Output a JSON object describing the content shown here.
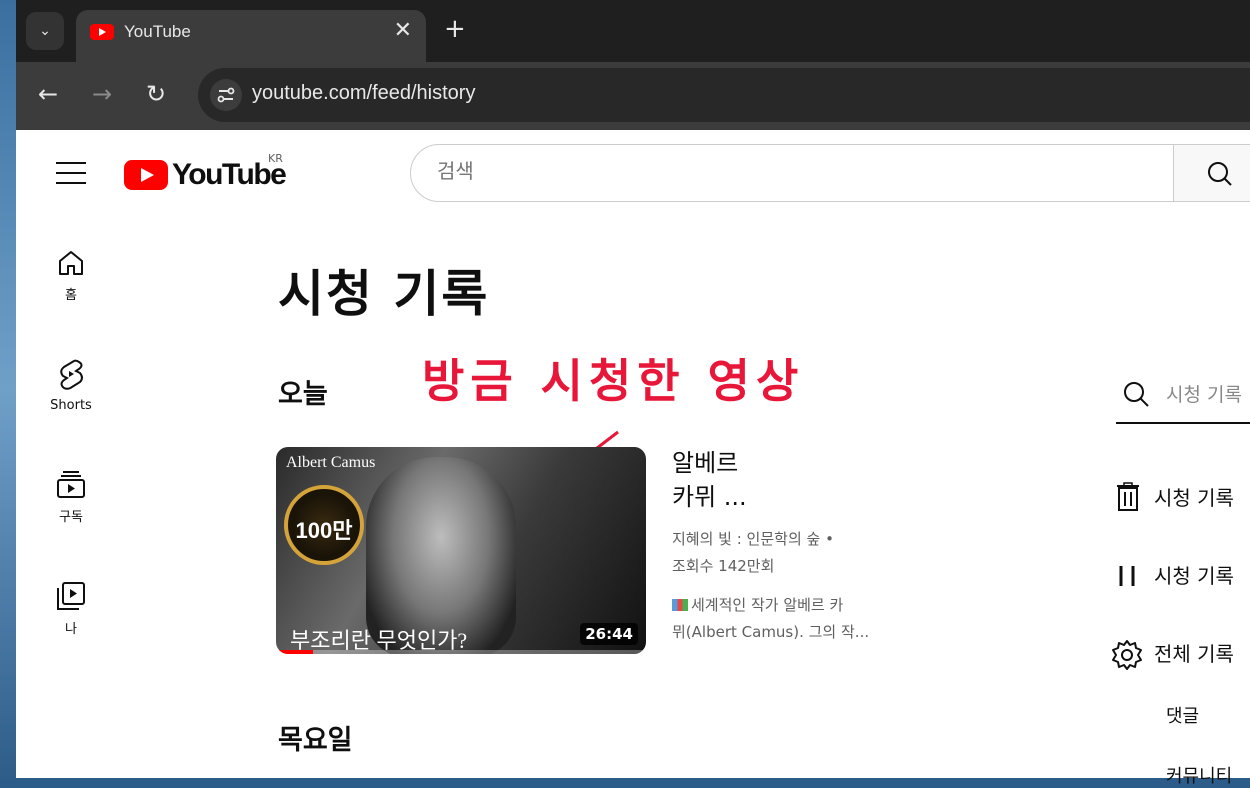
{
  "browser": {
    "tab_title": "YouTube",
    "tab_close": "✕",
    "new_tab": "+",
    "tab_menu": "⌄",
    "url": "youtube.com/feed/history",
    "back": "←",
    "forward": "→",
    "reload": "↻"
  },
  "header": {
    "logo_text": "YouTube",
    "region": "KR",
    "search_placeholder": "검색"
  },
  "sidebar": {
    "items": [
      {
        "label": "홈",
        "icon": "home-icon"
      },
      {
        "label": "Shorts",
        "icon": "shorts-icon"
      },
      {
        "label": "구독",
        "icon": "subscriptions-icon"
      },
      {
        "label": "나",
        "icon": "you-icon"
      }
    ]
  },
  "main": {
    "page_title": "시청 기록",
    "annotation": "방금 시청한 영상",
    "sections": [
      {
        "heading": "오늘"
      },
      {
        "heading": "목요일"
      }
    ],
    "video": {
      "thumb_channel": "Albert Camus",
      "thumb_badge": "100만",
      "thumb_caption": "부조리란 무엇인가?",
      "duration": "26:44",
      "watched_fraction": 0.1,
      "title_line1": "알베르",
      "title_line2": "카뮈 ...",
      "channel_line": "지혜의 빛 : 인문학의 숲 •",
      "views": "조회수 142만회",
      "desc_line1": "세계적인 작가 알베르 카",
      "desc_line2": "뮈(Albert Camus). 그의 작..."
    }
  },
  "right_panel": {
    "search_placeholder": "시청 기록",
    "clear_label": "시청 기록",
    "pause_label": "시청 기록",
    "manage_label": "전체 기록",
    "comments_label": "댓글",
    "community_label": "커뮤니티"
  },
  "colors": {
    "accent_red": "#ff0000",
    "annotation_red": "#e8173a"
  }
}
